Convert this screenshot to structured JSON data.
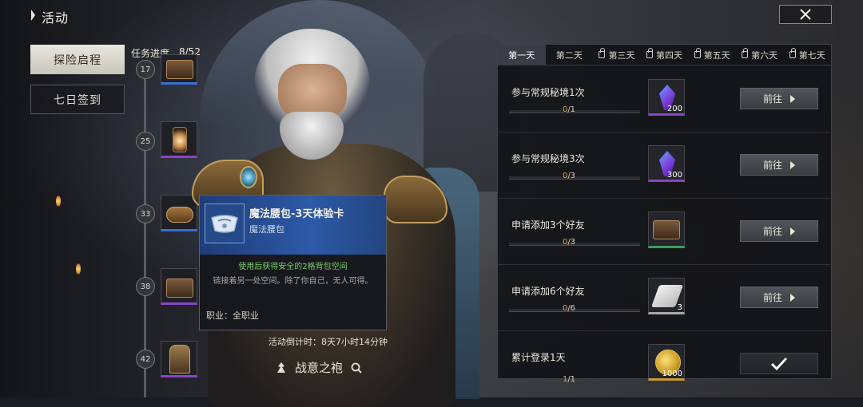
{
  "header": {
    "title": "活动"
  },
  "menu": {
    "items": [
      {
        "label": "探险启程"
      },
      {
        "label": "七日签到"
      }
    ]
  },
  "progress": {
    "label": "任务进度",
    "count": "8/52",
    "milestones": [
      "17",
      "25",
      "33",
      "38",
      "42"
    ]
  },
  "tooltip": {
    "title": "魔法腰包-3天体验卡",
    "subtitle": "魔法腰包",
    "effect": "使用后获得安全的2格背包空间",
    "description": "链接着另一处空间。除了你自己，无人可得。",
    "class_label": "职业：",
    "class_value": "全职业"
  },
  "countdown": "活动倒计时：8天7小时14分钟",
  "character": {
    "name": "战意之袍"
  },
  "tabs": [
    {
      "label": "第一天",
      "locked": false
    },
    {
      "label": "第二天",
      "locked": false
    },
    {
      "label": "第三天",
      "locked": true
    },
    {
      "label": "第四天",
      "locked": true
    },
    {
      "label": "第五天",
      "locked": true
    },
    {
      "label": "第六天",
      "locked": true
    },
    {
      "label": "第七天",
      "locked": true
    }
  ],
  "tasks": [
    {
      "name": "参与常规秘境1次",
      "current": "0",
      "total": "/1",
      "qty": "200",
      "action": "前往",
      "icon": "crystal-icon"
    },
    {
      "name": "参与常规秘境3次",
      "current": "0",
      "total": "/3",
      "qty": "300",
      "action": "前往",
      "icon": "crystal-icon"
    },
    {
      "name": "申请添加3个好友",
      "current": "0",
      "total": "/3",
      "qty": "",
      "action": "前往",
      "icon": "chest-icon"
    },
    {
      "name": "申请添加6个好友",
      "current": "0",
      "total": "/6",
      "qty": "3",
      "action": "前往",
      "icon": "scroll-icon"
    },
    {
      "name": "累计登录1天",
      "current": "1",
      "total": "/1",
      "qty": "1000",
      "action": "",
      "icon": "coin-icon"
    }
  ],
  "colors": {
    "accent_blue": "#2c5aa8",
    "progress_orange": "#d6a24a",
    "green_text": "#7ad06a"
  }
}
